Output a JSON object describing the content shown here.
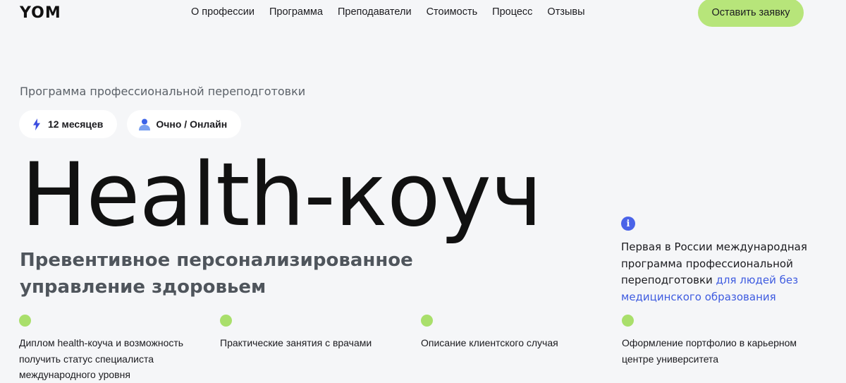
{
  "header": {
    "logo": "YOM",
    "nav": [
      "О профессии",
      "Программа",
      "Преподаватели",
      "Стоимость",
      "Процесс",
      "Отзывы"
    ],
    "cta_label": "Оставить заявку"
  },
  "hero": {
    "eyebrow": "Программа профессиональной переподготовки",
    "chips": [
      {
        "icon": "lightning-icon",
        "label": "12 месяцев"
      },
      {
        "icon": "person-icon",
        "label": "Очно / Онлайн"
      }
    ],
    "title": "Health-коуч",
    "subtitle": "Превентивное персонализированное управление здоровьем"
  },
  "info": {
    "icon": "info-icon",
    "icon_glyph": "i",
    "text": "Первая в России международная программа профессиональной переподготовки ",
    "link": "для людей без медицинского образования"
  },
  "features": [
    "Диплом health-коуча и возможность получить статус специалиста международного уровня",
    "Практические занятия с врачами",
    "Описание клиентского случая",
    "Оформление портфолио в карьерном центре университета"
  ],
  "colors": {
    "accent_green": "#b7e57a",
    "dot_green": "#a9df6b",
    "accent_blue": "#4a63e8",
    "background": "#f5f6f8"
  }
}
